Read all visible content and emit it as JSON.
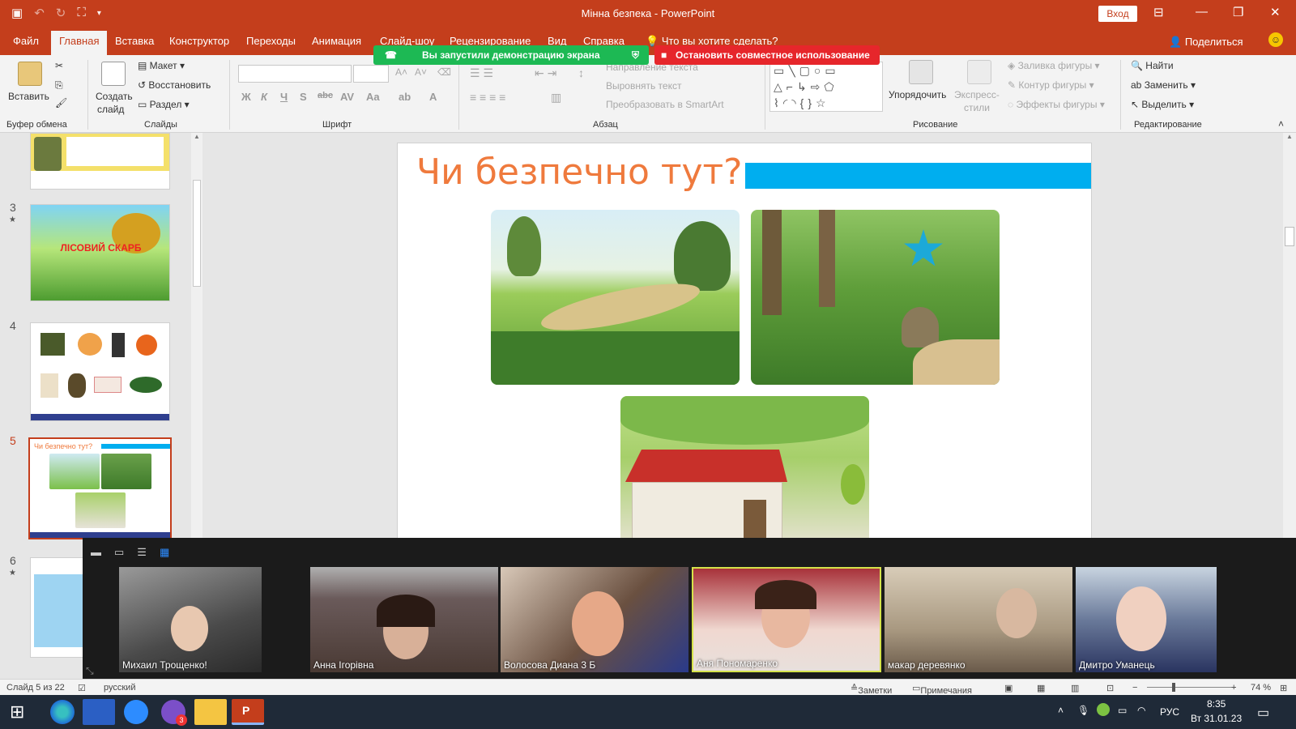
{
  "window": {
    "title": "Мінна безпека  -  PowerPoint",
    "signin": "Вход"
  },
  "menu": {
    "tabs": [
      "Файл",
      "Главная",
      "Вставка",
      "Конструктор",
      "Переходы",
      "Анимация",
      "Слайд-шоу",
      "Рецензирование",
      "Вид",
      "Справка"
    ],
    "active_tab": "Главная",
    "tell_me": "Что вы хотите сделать?",
    "share": "Поделиться"
  },
  "ribbon": {
    "clipboard": {
      "paste": "Вставить",
      "label": "Буфер обмена"
    },
    "slides": {
      "new_slide_1": "Создать",
      "new_slide_2": "слайд",
      "layout": "Макет",
      "reset": "Восстановить",
      "section": "Раздел",
      "label": "Слайды"
    },
    "font": {
      "label": "Шрифт"
    },
    "paragraph": {
      "text_direction": "Направление текста",
      "align_text": "Выровнять текст",
      "smartart": "Преобразовать в SmartArt",
      "label": "Абзац"
    },
    "drawing": {
      "arrange": "Упорядочить",
      "quick_styles_1": "Экспресс-",
      "quick_styles_2": "стили",
      "fill": "Заливка фигуры",
      "outline": "Контур фигуры",
      "effects": "Эффекты фигуры",
      "label": "Рисование"
    },
    "editing": {
      "find": "Найти",
      "replace": "Заменить",
      "select": "Выделить",
      "label": "Редактирование"
    }
  },
  "share_banner": {
    "sharing": "Вы запустили демонстрацию экрана",
    "stop": "Остановить совместное использование"
  },
  "thumbnails": [
    {
      "num": "3",
      "star": true,
      "title": "ЛІСОВИЙ СКАРБ"
    },
    {
      "num": "4",
      "star": false
    },
    {
      "num": "5",
      "star": false,
      "selected": true,
      "title": "Чи безпечно тут?"
    },
    {
      "num": "6",
      "star": true
    }
  ],
  "slide": {
    "title": "Чи безпечно тут?"
  },
  "zoom": {
    "participants": [
      "Михаил Трощенко!",
      "Анна Ігорівна",
      "Волосова Диана 3 Б",
      "Аня Пономаренко",
      "макар деревянко",
      "Дмитро Уманець"
    ],
    "active_speaker": "Аня Пономаренко"
  },
  "statusbar": {
    "slide_info": "Слайд 5 из 22",
    "language": "русский",
    "notes": "Заметки",
    "comments": "Примечания",
    "zoom_level": "74 %"
  },
  "taskbar": {
    "lang": "РУС",
    "time": "8:35",
    "date": "Вт 31.01.23",
    "badge": "3"
  },
  "colors": {
    "accent": "#c43e1c",
    "slide_title": "#ef7a3d",
    "slide_bar": "#00aeef",
    "share_green": "#1db954",
    "share_red": "#e6262b"
  }
}
